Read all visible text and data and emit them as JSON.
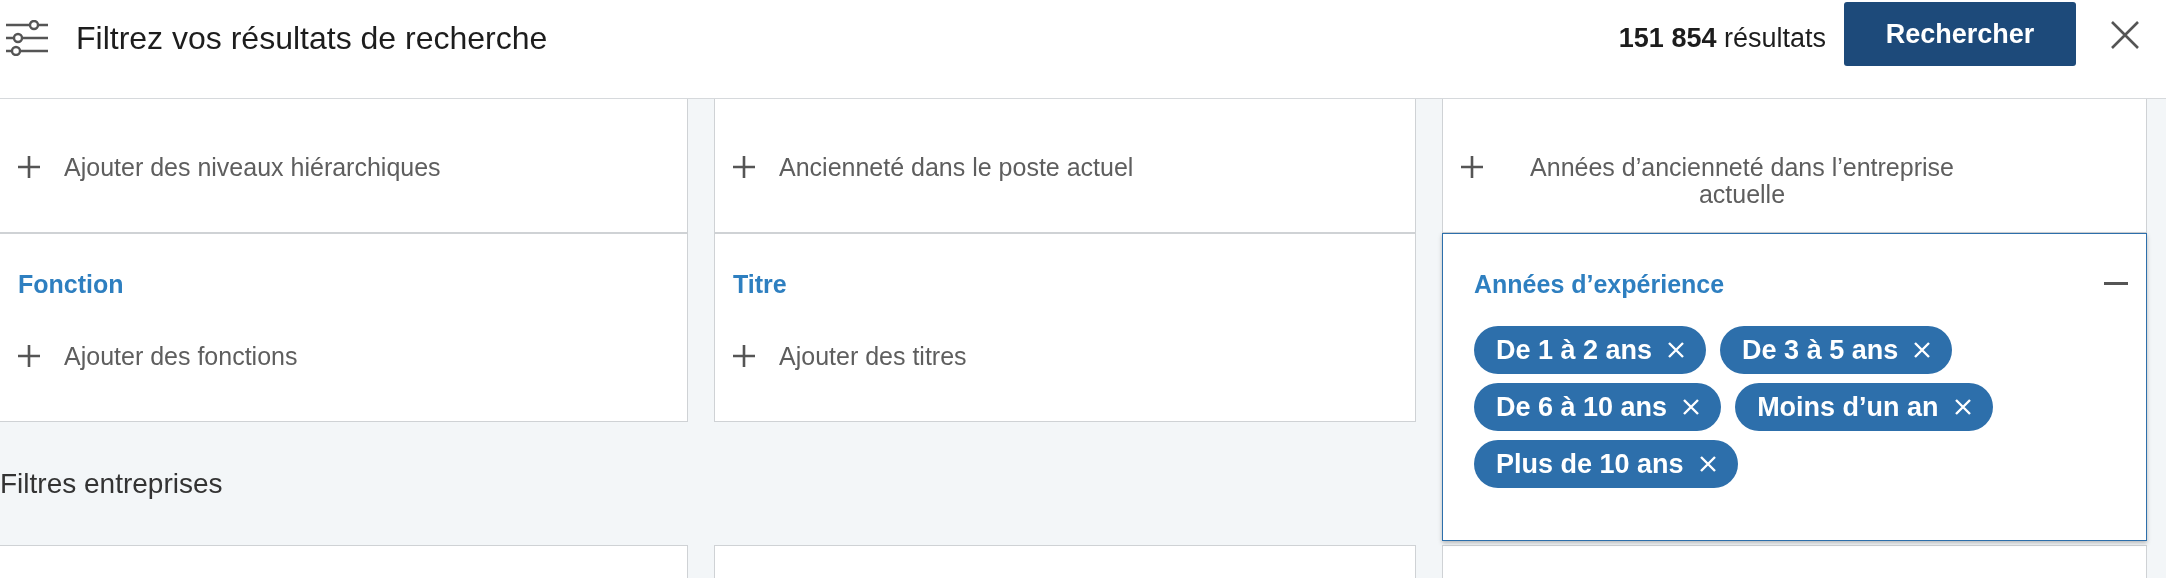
{
  "header": {
    "title": "Filtrez vos résultats de recherche",
    "results_count": "151 854",
    "results_label": "résultats",
    "search_button": "Rechercher"
  },
  "card_rows": [
    {
      "cards": [
        {
          "expanded": false,
          "add_label": "Ajouter des niveaux hiérarchiques"
        },
        {
          "expanded": false,
          "add_label": "Ancienneté dans le poste actuel"
        },
        {
          "expanded": false,
          "add_label": "Années d’ancienneté dans l’entreprise actuelle"
        }
      ]
    },
    {
      "cards": [
        {
          "title": "Fonction",
          "expanded": false,
          "add_label": "Ajouter des fonctions"
        },
        {
          "title": "Titre",
          "expanded": false,
          "add_label": "Ajouter des titres"
        },
        {
          "title": "Années d’expérience",
          "expanded": true,
          "chips": [
            "De 1 à 2 ans",
            "De 3 à 5 ans",
            "De 6 à 10 ans",
            "Moins d’un an",
            "Plus de 10 ans"
          ]
        }
      ]
    }
  ],
  "section": {
    "title": "Filtres entreprises"
  }
}
